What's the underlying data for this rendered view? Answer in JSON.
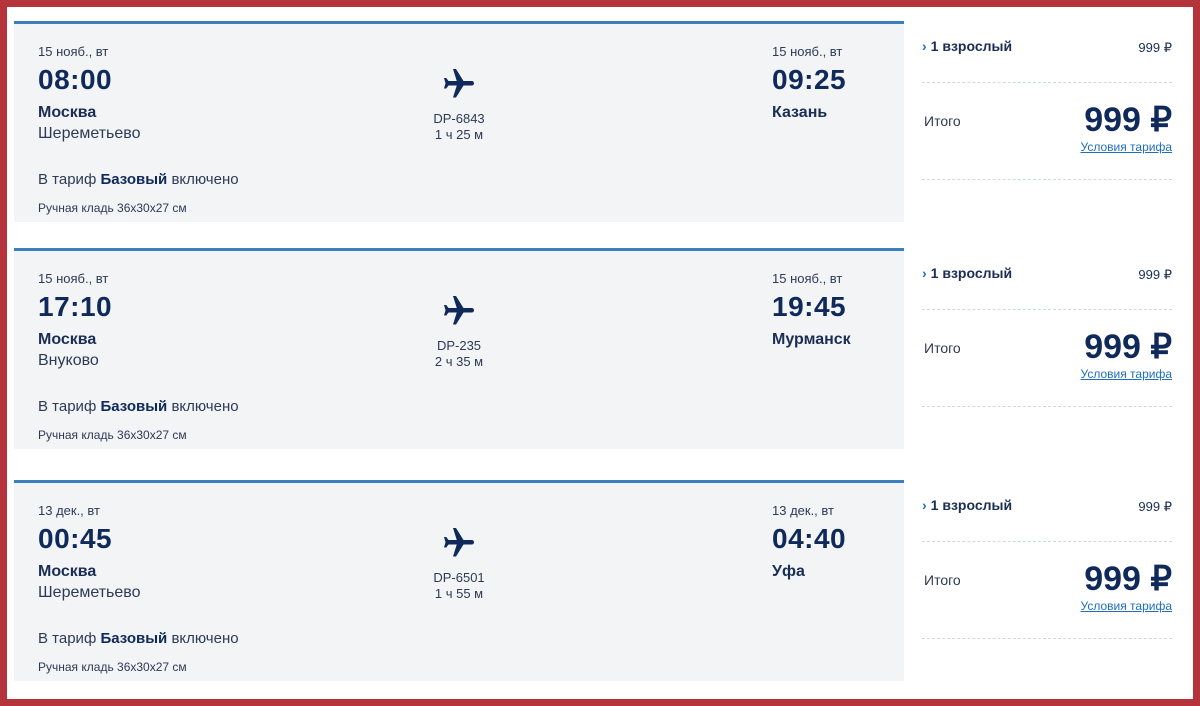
{
  "flights": [
    {
      "depart_date": "15 нояб., вт",
      "depart_time": "08:00",
      "depart_city": "Москва",
      "depart_airport": "Шереметьево",
      "flight_number": "DP-6843",
      "duration": "1 ч 25 м",
      "arrive_date": "15 нояб., вт",
      "arrive_time": "09:25",
      "arrive_city": "Казань",
      "tariff_prefix": "В тариф",
      "tariff_name": "Базовый",
      "tariff_suffix": "включено",
      "baggage": "Ручная кладь 36х30х27 см",
      "passenger_label": "1 взрослый",
      "passenger_price": "999 ₽",
      "total_label": "Итого",
      "total_price": "999 ₽",
      "terms_link": "Условия тарифа"
    },
    {
      "depart_date": "15 нояб., вт",
      "depart_time": "17:10",
      "depart_city": "Москва",
      "depart_airport": "Внуково",
      "flight_number": "DP-235",
      "duration": "2 ч 35 м",
      "arrive_date": "15 нояб., вт",
      "arrive_time": "19:45",
      "arrive_city": "Мурманск",
      "tariff_prefix": "В тариф",
      "tariff_name": "Базовый",
      "tariff_suffix": "включено",
      "baggage": "Ручная кладь 36х30х27 см",
      "passenger_label": "1 взрослый",
      "passenger_price": "999 ₽",
      "total_label": "Итого",
      "total_price": "999 ₽",
      "terms_link": "Условия тарифа"
    },
    {
      "depart_date": "13 дек., вт",
      "depart_time": "00:45",
      "depart_city": "Москва",
      "depart_airport": "Шереметьево",
      "flight_number": "DP-6501",
      "duration": "1 ч 55 м",
      "arrive_date": "13 дек., вт",
      "arrive_time": "04:40",
      "arrive_city": "Уфа",
      "tariff_prefix": "В тариф",
      "tariff_name": "Базовый",
      "tariff_suffix": "включено",
      "baggage": "Ручная кладь 36х30х27 см",
      "passenger_label": "1 взрослый",
      "passenger_price": "999 ₽",
      "total_label": "Итого",
      "total_price": "999 ₽",
      "terms_link": "Условия тарифа"
    }
  ],
  "icons": {
    "plane": "airplane-icon",
    "chevron": "chevron-right-icon"
  },
  "colors": {
    "frame": "#b5333a",
    "card_accent": "#3a7fbf",
    "card_bg": "#f2f4f6",
    "text_dark": "#0f2a5a",
    "link": "#1e6ec0"
  }
}
